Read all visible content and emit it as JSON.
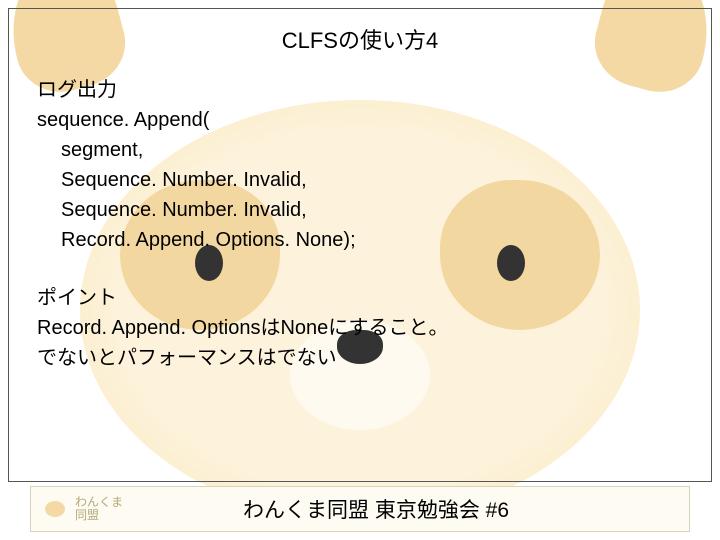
{
  "slide": {
    "title": "CLFSの使い方4",
    "section1": {
      "heading": "ログ出力",
      "code_line1": "sequence. Append(",
      "code_line2": "segment,",
      "code_line3": "Sequence. Number. Invalid,",
      "code_line4": "Sequence. Number. Invalid,",
      "code_line5": "Record. Append. Options. None);"
    },
    "section2": {
      "heading": "ポイント",
      "line1": "Record. Append. OptionsはNoneにすること。",
      "line2": "でないとパフォーマンスはでない"
    }
  },
  "footer": {
    "logo_line1": "わんくま",
    "logo_line2": "同盟",
    "text": "わんくま同盟 東京勉強会 #6"
  }
}
